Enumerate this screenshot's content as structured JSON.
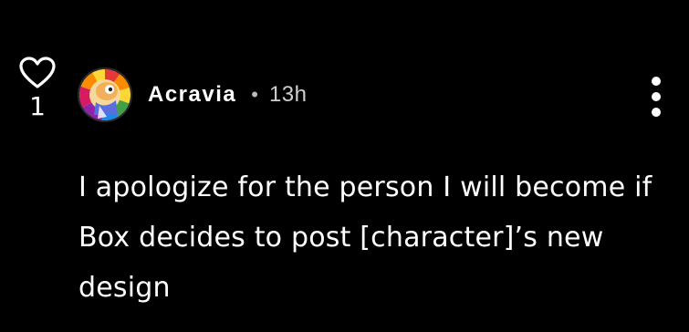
{
  "comment": {
    "likes": "1",
    "author": "Acravia",
    "separator": "•",
    "time": "13h",
    "text": "I apologize for the person I will become if Box decides to post [character]’s new design"
  },
  "icons": {
    "like": "heart-outline-icon",
    "more": "vertical-ellipsis-icon"
  },
  "colors": {
    "background": "#000000",
    "text": "#ffffff",
    "muted": "#cfcfcf"
  }
}
